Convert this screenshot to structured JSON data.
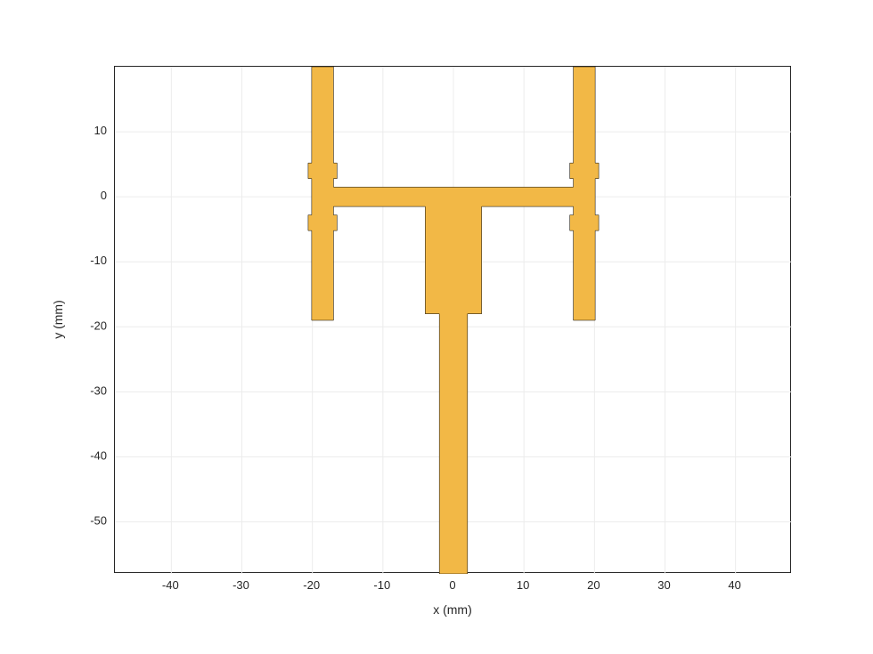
{
  "chart_data": {
    "type": "area",
    "title": "",
    "xlabel": "x (mm)",
    "ylabel": "y (mm)",
    "xlim": [
      -48,
      48
    ],
    "ylim": [
      -58,
      20
    ],
    "xticks": [
      -40,
      -30,
      -20,
      -10,
      0,
      10,
      20,
      30,
      40
    ],
    "yticks": [
      -50,
      -40,
      -30,
      -20,
      -10,
      0,
      10
    ],
    "shape_polygon_xy": [
      [
        -2,
        -58
      ],
      [
        -2,
        -18
      ],
      [
        -4,
        -18
      ],
      [
        -4,
        -1.5
      ],
      [
        -17,
        -1.5
      ],
      [
        -17,
        -2.8
      ],
      [
        -16.5,
        -2.8
      ],
      [
        -16.5,
        -5.2
      ],
      [
        -17,
        -5.2
      ],
      [
        -17,
        -19
      ],
      [
        -20.1,
        -19
      ],
      [
        -20.1,
        -5.2
      ],
      [
        -20.6,
        -5.2
      ],
      [
        -20.6,
        -2.8
      ],
      [
        -20.1,
        -2.8
      ],
      [
        -20.1,
        2.8
      ],
      [
        -20.6,
        2.8
      ],
      [
        -20.6,
        5.2
      ],
      [
        -20.1,
        5.2
      ],
      [
        -20.1,
        20
      ],
      [
        -17,
        20
      ],
      [
        -17,
        5.2
      ],
      [
        -16.5,
        5.2
      ],
      [
        -16.5,
        2.8
      ],
      [
        -17,
        2.8
      ],
      [
        -17,
        1.5
      ],
      [
        17,
        1.5
      ],
      [
        17,
        2.8
      ],
      [
        16.5,
        2.8
      ],
      [
        16.5,
        5.2
      ],
      [
        17,
        5.2
      ],
      [
        17,
        20
      ],
      [
        20.1,
        20
      ],
      [
        20.1,
        5.2
      ],
      [
        20.6,
        5.2
      ],
      [
        20.6,
        2.8
      ],
      [
        20.1,
        2.8
      ],
      [
        20.1,
        -2.8
      ],
      [
        20.6,
        -2.8
      ],
      [
        20.6,
        -5.2
      ],
      [
        20.1,
        -5.2
      ],
      [
        20.1,
        -19
      ],
      [
        17,
        -19
      ],
      [
        17,
        -5.2
      ],
      [
        16.5,
        -5.2
      ],
      [
        16.5,
        -2.8
      ],
      [
        17,
        -2.8
      ],
      [
        17,
        -1.5
      ],
      [
        4,
        -1.5
      ],
      [
        4,
        -18
      ],
      [
        2,
        -18
      ],
      [
        2,
        -58
      ]
    ],
    "grid": true,
    "legend": null,
    "fill_color": "#f2b846",
    "edge_color": "#000000"
  }
}
